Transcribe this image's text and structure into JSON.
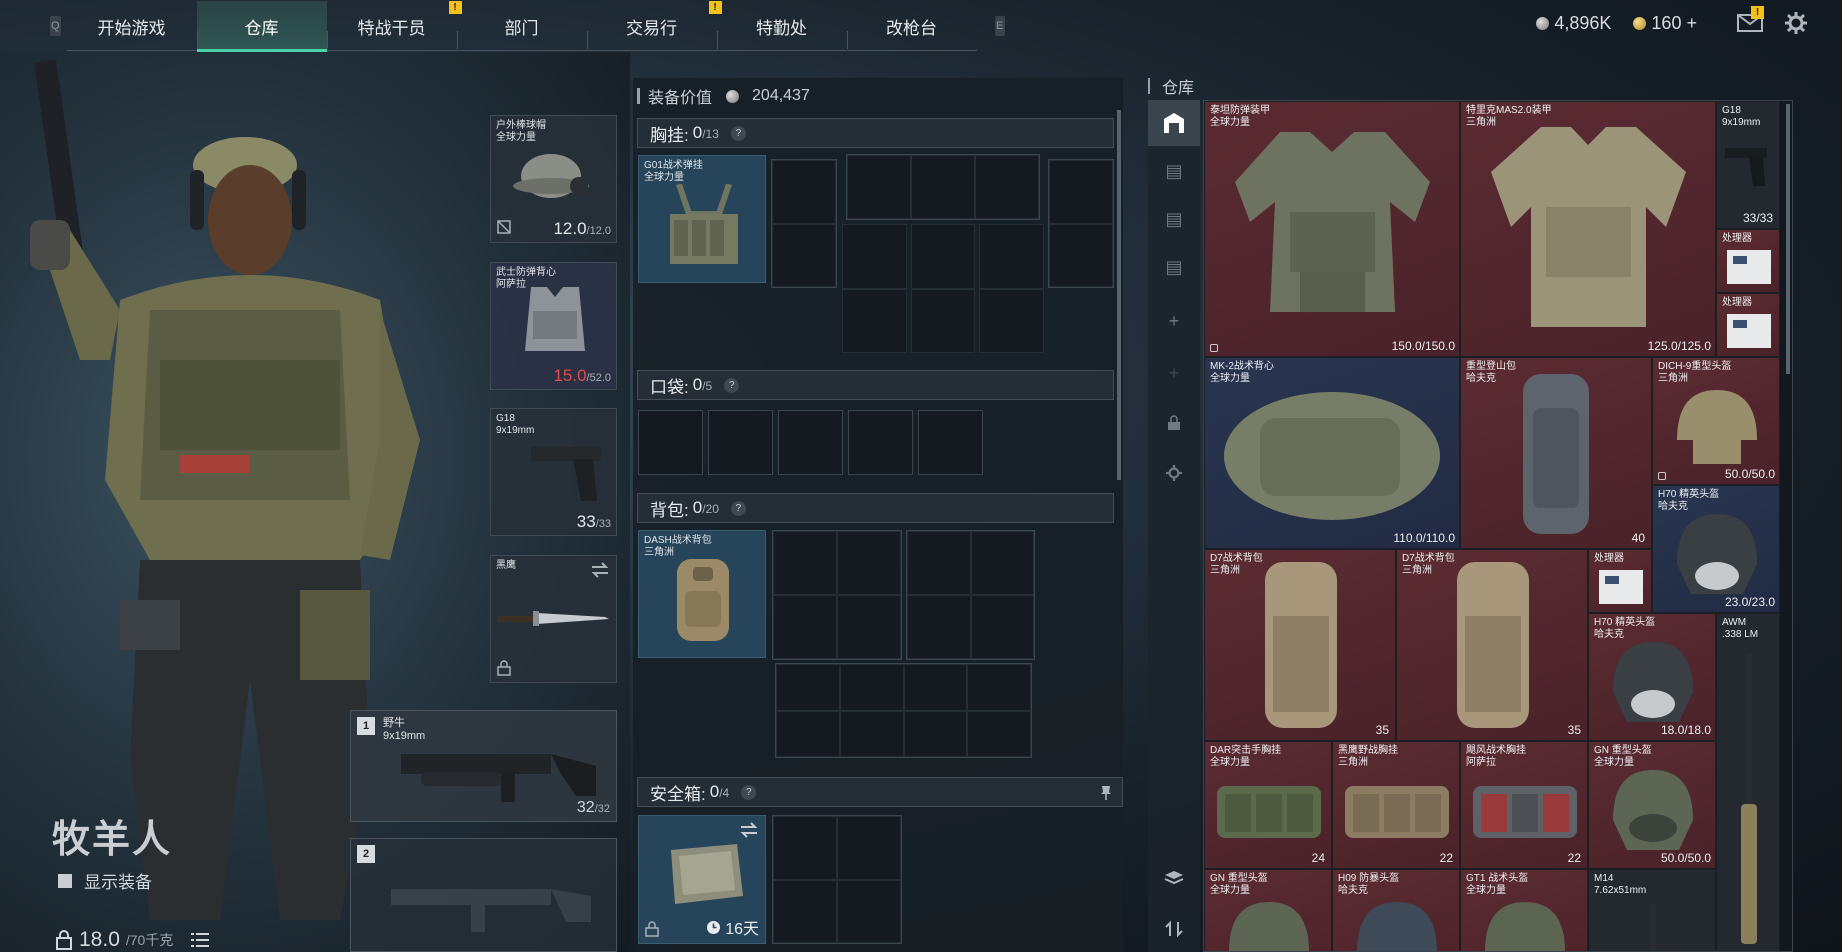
{
  "nav": {
    "key_left": "Q",
    "key_right": "E",
    "tabs": [
      {
        "label": "开始游戏",
        "alert": false
      },
      {
        "label": "仓库",
        "alert": false,
        "active": true
      },
      {
        "label": "特战干员",
        "alert": false
      },
      {
        "label": "部门",
        "alert": true
      },
      {
        "label": "交易行",
        "alert": false
      },
      {
        "label": "特勤处",
        "alert": true
      },
      {
        "label": "改枪台",
        "alert": false
      }
    ],
    "alert_mark": "!"
  },
  "currency": {
    "silver": "4,896K",
    "gold": "160",
    "gold_plus": "+"
  },
  "topright": {
    "mail_alert": "!"
  },
  "character": {
    "name": "牧羊人",
    "show_equipment_label": "显示装备",
    "weight_value": "18.0",
    "weight_max": "/70千克"
  },
  "equipment": {
    "helmet": {
      "name_line1": "户外棒球帽",
      "name_line2": "全球力量",
      "dur": "12.0",
      "dur_max": "/12.0"
    },
    "armor": {
      "name_line1": "武士防弹背心",
      "name_line2": "阿萨拉",
      "dur": "15.0",
      "dur_max": "/52.0"
    },
    "pistol": {
      "name_line1": "G18",
      "name_line2": "9x19mm",
      "ammo": "33",
      "ammo_max": "/33"
    },
    "melee": {
      "name_line1": "黑鹰"
    },
    "primary": {
      "slot": "1",
      "name_line1": "野牛",
      "name_line2": "9x19mm",
      "ammo": "32",
      "ammo_max": "/32"
    },
    "secondary": {
      "slot": "2"
    }
  },
  "loadout": {
    "value_label": "装备价值",
    "value": "204,437",
    "chest_rig": {
      "label": "胸挂:",
      "count": "0",
      "capacity": "/13",
      "item_line1": "G01战术弹挂",
      "item_line2": "全球力量"
    },
    "pockets": {
      "label": "口袋:",
      "count": "0",
      "capacity": "/5"
    },
    "backpack": {
      "label": "背包:",
      "count": "0",
      "capacity": "/20",
      "item_line1": "DASH战术背包",
      "item_line2": "三角洲"
    },
    "safe_box": {
      "label": "安全箱:",
      "count": "0",
      "capacity": "/4",
      "days": "16天"
    },
    "help": "?"
  },
  "stash": {
    "title": "仓库",
    "items": {
      "armor_tanker": {
        "line1": "泰坦防弹装甲",
        "line2": "全球力量",
        "dur": "150.0/150.0"
      },
      "armor_mas": {
        "line1": "特里克MAS2.0装甲",
        "line2": "三角洲",
        "dur": "125.0/125.0"
      },
      "g18": {
        "line1": "G18",
        "line2": "9x19mm",
        "cnt": "33/33"
      },
      "proc1": {
        "line1": "处理器"
      },
      "proc2": {
        "line1": "处理器"
      },
      "mk2": {
        "line1": "MK-2战术背心",
        "line2": "全球力量",
        "dur": "110.0/110.0"
      },
      "bigbag": {
        "line1": "重型登山包",
        "line2": "哈夫克",
        "cnt": "40"
      },
      "dich9": {
        "line1": "DICH-9重型头盔",
        "line2": "三角洲",
        "dur": "50.0/50.0"
      },
      "h70a": {
        "line1": "H70 精英头盔",
        "line2": "哈夫克",
        "dur": "23.0/23.0"
      },
      "d7a": {
        "line1": "D7战术背包",
        "line2": "三角洲",
        "cnt": "35"
      },
      "d7b": {
        "line1": "D7战术背包",
        "line2": "三角洲",
        "cnt": "35"
      },
      "proc3": {
        "line1": "处理器"
      },
      "h70b": {
        "line1": "H70 精英头盔",
        "line2": "哈夫克",
        "dur": "18.0/18.0"
      },
      "awm": {
        "line1": "AWM",
        "line2": ".338 LM"
      },
      "dar": {
        "line1": "DAR突击手胸挂",
        "line2": "全球力量",
        "cnt": "24"
      },
      "heiying": {
        "line1": "黑鹰野战胸挂",
        "line2": "三角洲",
        "cnt": "22"
      },
      "jufeng": {
        "line1": "飓风战术胸挂",
        "line2": "阿萨拉",
        "cnt": "22"
      },
      "gn1": {
        "line1": "GN 重型头盔",
        "line2": "全球力量",
        "dur": "50.0/50.0"
      },
      "gn2": {
        "line1": "GN 重型头盔",
        "line2": "全球力量"
      },
      "h09": {
        "line1": "H09 防暴头盔",
        "line2": "哈夫克"
      },
      "gt1": {
        "line1": "GT1 战术头盔",
        "line2": "全球力量"
      },
      "m14": {
        "line1": "M14",
        "line2": "7.62x51mm"
      }
    }
  }
}
